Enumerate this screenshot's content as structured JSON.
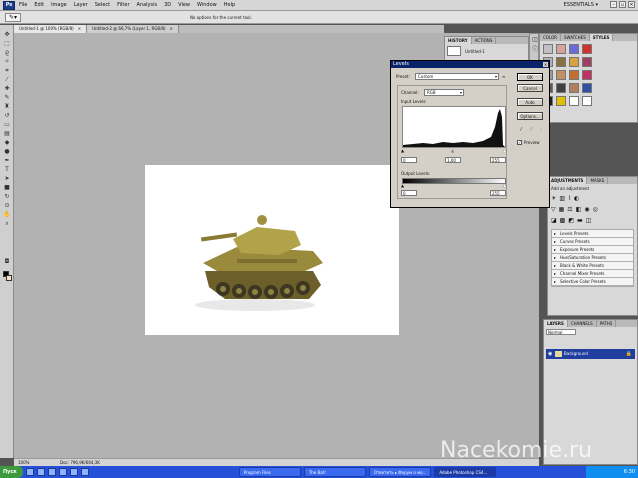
{
  "menubar": {
    "logo": "Ps",
    "items": [
      "File",
      "Edit",
      "Image",
      "Layer",
      "Select",
      "Filter",
      "Analysis",
      "3D",
      "View",
      "Window",
      "Help"
    ],
    "workspace": "ESSENTIALS ▾"
  },
  "options_bar": {
    "message": "No options for the current tool."
  },
  "doc_tabs": [
    {
      "label": "Untitled-1 @ 100% (RGB/8)"
    },
    {
      "label": "Untitled-2 @ 66,7% (Layer 1, RGB/8)"
    }
  ],
  "history_panel": {
    "tabs": [
      "HISTORY",
      "ACTIONS"
    ],
    "item": "Untitled-1"
  },
  "styles_panel": {
    "tabs": [
      "COLOR",
      "SWATCHES",
      "STYLES"
    ],
    "swatch_colors": [
      "#c0c0c0",
      "#d9a0a0",
      "#6a6ad9",
      "#d03030",
      "#b0b0b0",
      "#8a7040",
      "#d7a040",
      "#a04060",
      "#9a9a9a",
      "#c09060",
      "#c07030",
      "#c03060",
      "#5a5a5a",
      "#404040",
      "#b08060",
      "#3050a0",
      "#202020",
      "#e0c000",
      "#fff",
      "#fff"
    ]
  },
  "adjustments_panel": {
    "tabs": [
      "ADJUSTMENTS",
      "MASKS"
    ],
    "heading": "Add an adjustment",
    "presets": [
      "Levels Presets",
      "Curves Presets",
      "Exposure Presets",
      "Hue/Saturation Presets",
      "Black & White Presets",
      "Channel Mixer Presets",
      "Selective Color Presets"
    ]
  },
  "layers_panel": {
    "tabs": [
      "LAYERS",
      "CHANNELS",
      "PATHS"
    ],
    "blend_mode": "Normal",
    "layer_name": "Background"
  },
  "levels": {
    "title": "Levels",
    "preset_label": "Preset:",
    "preset_value": "Custom",
    "channel_label": "Channel:",
    "channel_value": "RGB",
    "input_label": "Input Levels:",
    "input_values": [
      "0",
      "1,00",
      "255"
    ],
    "output_label": "Output Levels:",
    "output_values": [
      "0",
      "255"
    ],
    "buttons": {
      "ok": "OK",
      "cancel": "Cancel",
      "auto": "Auto",
      "options": "Options..."
    },
    "preview_label": "Preview",
    "preview_checked": true
  },
  "statusbar": {
    "zoom": "100%",
    "doc": "Doc: 796,9K/664,3K"
  },
  "taskbar": {
    "start": "Пуск",
    "tasks": [
      "Program Files",
      "The Bat!",
      "Ответить ▸ Форум о мо...",
      "Adobe Photoshop CS4..."
    ],
    "clock": "6:30"
  },
  "watermark": "Nacekomie.ru"
}
